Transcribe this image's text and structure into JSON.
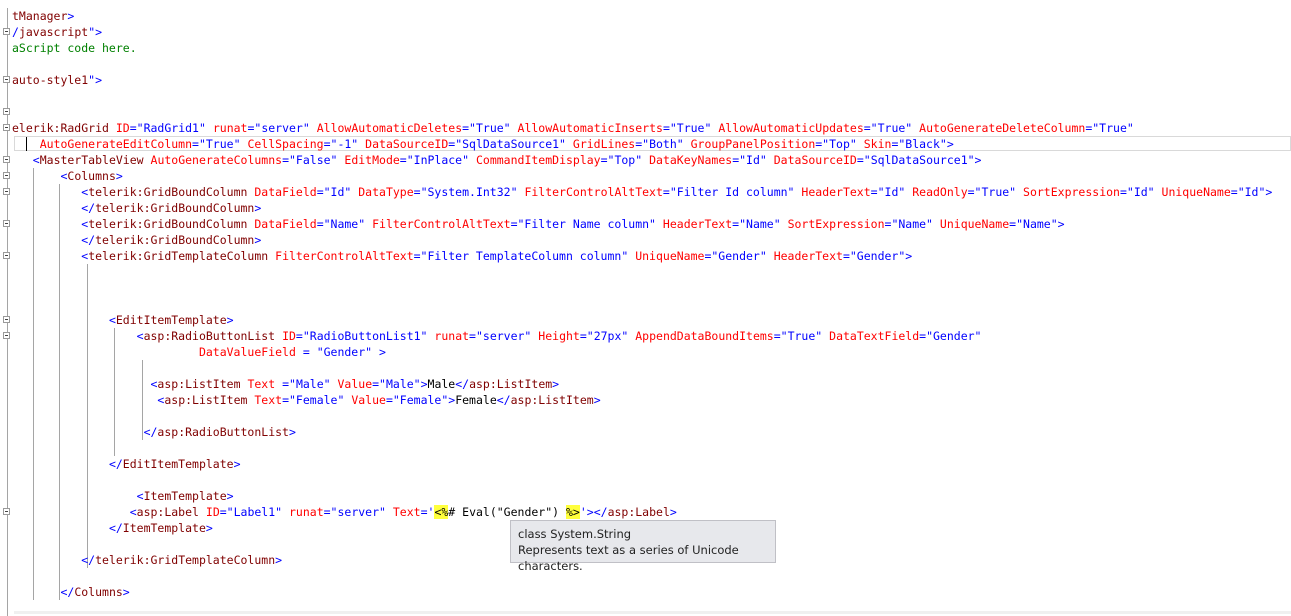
{
  "editor": {
    "lines": [
      [
        {
          "c": "m",
          "t": "tManager"
        },
        {
          "c": "b",
          "t": ">"
        }
      ],
      [
        {
          "c": "b",
          "t": "/"
        },
        {
          "c": "m",
          "t": "javascript"
        },
        {
          "c": "b",
          "t": "\">"
        }
      ],
      [
        {
          "c": "g",
          "t": "aScript code here."
        }
      ],
      [],
      [
        {
          "c": "m",
          "t": "auto-style1"
        },
        {
          "c": "b",
          "t": "\">"
        }
      ],
      [],
      [],
      [
        {
          "c": "m",
          "t": "elerik:RadGrid"
        },
        {
          "c": "t",
          "t": " "
        },
        {
          "c": "r",
          "t": "ID"
        },
        {
          "c": "b",
          "t": "=\"RadGrid1\""
        },
        {
          "c": "t",
          "t": " "
        },
        {
          "c": "r",
          "t": "runat"
        },
        {
          "c": "b",
          "t": "=\"server\""
        },
        {
          "c": "t",
          "t": " "
        },
        {
          "c": "r",
          "t": "AllowAutomaticDeletes"
        },
        {
          "c": "b",
          "t": "=\"True\""
        },
        {
          "c": "t",
          "t": " "
        },
        {
          "c": "r",
          "t": "AllowAutomaticInserts"
        },
        {
          "c": "b",
          "t": "=\"True\""
        },
        {
          "c": "t",
          "t": " "
        },
        {
          "c": "r",
          "t": "AllowAutomaticUpdates"
        },
        {
          "c": "b",
          "t": "=\"True\""
        },
        {
          "c": "t",
          "t": " "
        },
        {
          "c": "r",
          "t": "AutoGenerateDeleteColumn"
        },
        {
          "c": "b",
          "t": "=\"True\""
        }
      ],
      [
        {
          "c": "t",
          "t": "    "
        },
        {
          "c": "r",
          "t": "AutoGenerateEditColumn"
        },
        {
          "c": "b",
          "t": "=\"True\""
        },
        {
          "c": "t",
          "t": " "
        },
        {
          "c": "r",
          "t": "CellSpacing"
        },
        {
          "c": "b",
          "t": "=\"-1\""
        },
        {
          "c": "t",
          "t": " "
        },
        {
          "c": "r",
          "t": "DataSourceID"
        },
        {
          "c": "b",
          "t": "=\"SqlDataSource1\""
        },
        {
          "c": "t",
          "t": " "
        },
        {
          "c": "r",
          "t": "GridLines"
        },
        {
          "c": "b",
          "t": "=\"Both\""
        },
        {
          "c": "t",
          "t": " "
        },
        {
          "c": "r",
          "t": "GroupPanelPosition"
        },
        {
          "c": "b",
          "t": "=\"Top\""
        },
        {
          "c": "t",
          "t": " "
        },
        {
          "c": "r",
          "t": "Skin"
        },
        {
          "c": "b",
          "t": "=\"Black\">"
        }
      ],
      [
        {
          "c": "t",
          "t": "   "
        },
        {
          "c": "b",
          "t": "<"
        },
        {
          "c": "m",
          "t": "MasterTableView"
        },
        {
          "c": "t",
          "t": " "
        },
        {
          "c": "r",
          "t": "AutoGenerateColumns"
        },
        {
          "c": "b",
          "t": "=\"False\""
        },
        {
          "c": "t",
          "t": " "
        },
        {
          "c": "r",
          "t": "EditMode"
        },
        {
          "c": "b",
          "t": "=\"InPlace\""
        },
        {
          "c": "t",
          "t": " "
        },
        {
          "c": "r",
          "t": "CommandItemDisplay"
        },
        {
          "c": "b",
          "t": "=\"Top\""
        },
        {
          "c": "t",
          "t": " "
        },
        {
          "c": "r",
          "t": "DataKeyNames"
        },
        {
          "c": "b",
          "t": "=\"Id\""
        },
        {
          "c": "t",
          "t": " "
        },
        {
          "c": "r",
          "t": "DataSourceID"
        },
        {
          "c": "b",
          "t": "=\"SqlDataSource1\">"
        }
      ],
      [
        {
          "c": "t",
          "t": "       "
        },
        {
          "c": "b",
          "t": "<"
        },
        {
          "c": "m",
          "t": "Columns"
        },
        {
          "c": "b",
          "t": ">"
        }
      ],
      [
        {
          "c": "t",
          "t": "          "
        },
        {
          "c": "b",
          "t": "<"
        },
        {
          "c": "m",
          "t": "telerik:GridBoundColumn"
        },
        {
          "c": "t",
          "t": " "
        },
        {
          "c": "r",
          "t": "DataField"
        },
        {
          "c": "b",
          "t": "=\"Id\""
        },
        {
          "c": "t",
          "t": " "
        },
        {
          "c": "r",
          "t": "DataType"
        },
        {
          "c": "b",
          "t": "=\"System.Int32\""
        },
        {
          "c": "t",
          "t": " "
        },
        {
          "c": "r",
          "t": "FilterControlAltText"
        },
        {
          "c": "b",
          "t": "=\"Filter Id column\""
        },
        {
          "c": "t",
          "t": " "
        },
        {
          "c": "r",
          "t": "HeaderText"
        },
        {
          "c": "b",
          "t": "=\"Id\""
        },
        {
          "c": "t",
          "t": " "
        },
        {
          "c": "r",
          "t": "ReadOnly"
        },
        {
          "c": "b",
          "t": "=\"True\""
        },
        {
          "c": "t",
          "t": " "
        },
        {
          "c": "r",
          "t": "SortExpression"
        },
        {
          "c": "b",
          "t": "=\"Id\""
        },
        {
          "c": "t",
          "t": " "
        },
        {
          "c": "r",
          "t": "UniqueName"
        },
        {
          "c": "b",
          "t": "=\"Id\">"
        }
      ],
      [
        {
          "c": "t",
          "t": "          "
        },
        {
          "c": "b",
          "t": "</"
        },
        {
          "c": "m",
          "t": "telerik:GridBoundColumn"
        },
        {
          "c": "b",
          "t": ">"
        }
      ],
      [
        {
          "c": "t",
          "t": "          "
        },
        {
          "c": "b",
          "t": "<"
        },
        {
          "c": "m",
          "t": "telerik:GridBoundColumn"
        },
        {
          "c": "t",
          "t": " "
        },
        {
          "c": "r",
          "t": "DataField"
        },
        {
          "c": "b",
          "t": "=\"Name\""
        },
        {
          "c": "t",
          "t": " "
        },
        {
          "c": "r",
          "t": "FilterControlAltText"
        },
        {
          "c": "b",
          "t": "=\"Filter Name column\""
        },
        {
          "c": "t",
          "t": " "
        },
        {
          "c": "r",
          "t": "HeaderText"
        },
        {
          "c": "b",
          "t": "=\"Name\""
        },
        {
          "c": "t",
          "t": " "
        },
        {
          "c": "r",
          "t": "SortExpression"
        },
        {
          "c": "b",
          "t": "=\"Name\""
        },
        {
          "c": "t",
          "t": " "
        },
        {
          "c": "r",
          "t": "UniqueName"
        },
        {
          "c": "b",
          "t": "=\"Name\">"
        }
      ],
      [
        {
          "c": "t",
          "t": "          "
        },
        {
          "c": "b",
          "t": "</"
        },
        {
          "c": "m",
          "t": "telerik:GridBoundColumn"
        },
        {
          "c": "b",
          "t": ">"
        }
      ],
      [
        {
          "c": "t",
          "t": "          "
        },
        {
          "c": "b",
          "t": "<"
        },
        {
          "c": "m",
          "t": "telerik:GridTemplateColumn"
        },
        {
          "c": "t",
          "t": " "
        },
        {
          "c": "r",
          "t": "FilterControlAltText"
        },
        {
          "c": "b",
          "t": "=\"Filter TemplateColumn column\""
        },
        {
          "c": "t",
          "t": " "
        },
        {
          "c": "r",
          "t": "UniqueName"
        },
        {
          "c": "b",
          "t": "=\"Gender\""
        },
        {
          "c": "t",
          "t": " "
        },
        {
          "c": "r",
          "t": "HeaderText"
        },
        {
          "c": "b",
          "t": "=\"Gender\">"
        }
      ],
      [],
      [],
      [],
      [
        {
          "c": "t",
          "t": "              "
        },
        {
          "c": "b",
          "t": "<"
        },
        {
          "c": "m",
          "t": "EditItemTemplate"
        },
        {
          "c": "b",
          "t": ">"
        }
      ],
      [
        {
          "c": "t",
          "t": "                  "
        },
        {
          "c": "b",
          "t": "<"
        },
        {
          "c": "m",
          "t": "asp:RadioButtonList"
        },
        {
          "c": "t",
          "t": " "
        },
        {
          "c": "r",
          "t": "ID"
        },
        {
          "c": "b",
          "t": "=\"RadioButtonList1\""
        },
        {
          "c": "t",
          "t": " "
        },
        {
          "c": "r",
          "t": "runat"
        },
        {
          "c": "b",
          "t": "=\"server\""
        },
        {
          "c": "t",
          "t": " "
        },
        {
          "c": "r",
          "t": "Height"
        },
        {
          "c": "b",
          "t": "=\"27px\""
        },
        {
          "c": "t",
          "t": " "
        },
        {
          "c": "r",
          "t": "AppendDataBoundItems"
        },
        {
          "c": "b",
          "t": "=\"True\""
        },
        {
          "c": "t",
          "t": " "
        },
        {
          "c": "r",
          "t": "DataTextField"
        },
        {
          "c": "b",
          "t": "=\"Gender\""
        }
      ],
      [
        {
          "c": "t",
          "t": "                           "
        },
        {
          "c": "r",
          "t": "DataValueField"
        },
        {
          "c": "t",
          "t": " "
        },
        {
          "c": "b",
          "t": "="
        },
        {
          "c": "t",
          "t": " "
        },
        {
          "c": "b",
          "t": "\"Gender\""
        },
        {
          "c": "t",
          "t": " "
        },
        {
          "c": "b",
          "t": ">"
        }
      ],
      [],
      [
        {
          "c": "t",
          "t": "                    "
        },
        {
          "c": "b",
          "t": "<"
        },
        {
          "c": "m",
          "t": "asp:ListItem"
        },
        {
          "c": "t",
          "t": " "
        },
        {
          "c": "r",
          "t": "Text"
        },
        {
          "c": "t",
          "t": " "
        },
        {
          "c": "b",
          "t": "=\"Male\""
        },
        {
          "c": "t",
          "t": " "
        },
        {
          "c": "r",
          "t": "Value"
        },
        {
          "c": "b",
          "t": "=\"Male\">"
        },
        {
          "c": "t",
          "t": "Male"
        },
        {
          "c": "b",
          "t": "</"
        },
        {
          "c": "m",
          "t": "asp:ListItem"
        },
        {
          "c": "b",
          "t": ">"
        }
      ],
      [
        {
          "c": "t",
          "t": "                     "
        },
        {
          "c": "b",
          "t": "<"
        },
        {
          "c": "m",
          "t": "asp:ListItem"
        },
        {
          "c": "t",
          "t": " "
        },
        {
          "c": "r",
          "t": "Text"
        },
        {
          "c": "b",
          "t": "=\"Female\""
        },
        {
          "c": "t",
          "t": " "
        },
        {
          "c": "r",
          "t": "Value"
        },
        {
          "c": "b",
          "t": "=\"Female\">"
        },
        {
          "c": "t",
          "t": "Female"
        },
        {
          "c": "b",
          "t": "</"
        },
        {
          "c": "m",
          "t": "asp:ListItem"
        },
        {
          "c": "b",
          "t": ">"
        }
      ],
      [],
      [
        {
          "c": "t",
          "t": "                   "
        },
        {
          "c": "b",
          "t": "</"
        },
        {
          "c": "m",
          "t": "asp:RadioButtonList"
        },
        {
          "c": "b",
          "t": ">"
        }
      ],
      [],
      [
        {
          "c": "t",
          "t": "              "
        },
        {
          "c": "b",
          "t": "</"
        },
        {
          "c": "m",
          "t": "EditItemTemplate"
        },
        {
          "c": "b",
          "t": ">"
        }
      ],
      [],
      [
        {
          "c": "t",
          "t": "                  "
        },
        {
          "c": "b",
          "t": "<"
        },
        {
          "c": "m",
          "t": "ItemTemplate"
        },
        {
          "c": "b",
          "t": ">"
        }
      ],
      [
        {
          "c": "t",
          "t": "                 "
        },
        {
          "c": "b",
          "t": "<"
        },
        {
          "c": "m",
          "t": "asp:Label"
        },
        {
          "c": "t",
          "t": " "
        },
        {
          "c": "r",
          "t": "ID"
        },
        {
          "c": "b",
          "t": "=\"Label1\""
        },
        {
          "c": "t",
          "t": " "
        },
        {
          "c": "r",
          "t": "runat"
        },
        {
          "c": "b",
          "t": "=\"server\""
        },
        {
          "c": "t",
          "t": " "
        },
        {
          "c": "r",
          "t": "Text"
        },
        {
          "c": "b",
          "t": "='"
        },
        {
          "c": "hl",
          "t": "<%"
        },
        {
          "c": "t",
          "t": "# Eval(\"Gender\") "
        },
        {
          "c": "hl",
          "t": "%>"
        },
        {
          "c": "b",
          "t": "'></"
        },
        {
          "c": "m",
          "t": "asp:Label"
        },
        {
          "c": "b",
          "t": ">"
        }
      ],
      [
        {
          "c": "t",
          "t": "              "
        },
        {
          "c": "b",
          "t": "</"
        },
        {
          "c": "m",
          "t": "ItemTemplate"
        },
        {
          "c": "b",
          "t": ">"
        }
      ],
      [],
      [
        {
          "c": "t",
          "t": "          "
        },
        {
          "c": "b",
          "t": "</"
        },
        {
          "c": "m",
          "t": "telerik:GridTemplateColumn"
        },
        {
          "c": "b",
          "t": ">"
        }
      ],
      [],
      [
        {
          "c": "t",
          "t": "       "
        },
        {
          "c": "b",
          "t": "</"
        },
        {
          "c": "m",
          "t": "Columns"
        },
        {
          "c": "b",
          "t": ">"
        }
      ]
    ]
  },
  "tooltip": {
    "title": "class System.String",
    "description": "Represents text as a series of Unicode characters."
  }
}
